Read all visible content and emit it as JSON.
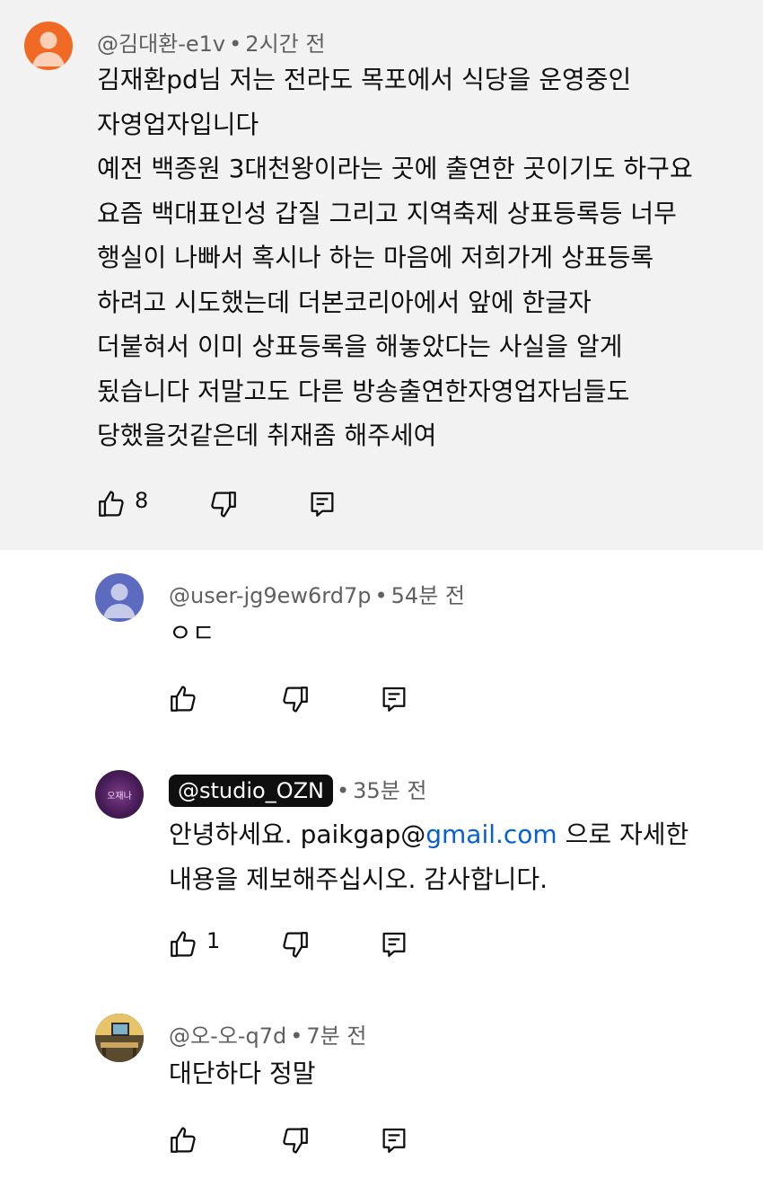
{
  "comments": [
    {
      "handle": "@김대환-e1v",
      "time": "2시간 전",
      "lines": [
        "김재환pd님 저는 전라도 목포에서 식당을 운영중인",
        "자영업자입니다",
        "예전 백종원 3대천왕이라는 곳에 출연한 곳이기도 하구요",
        "요즘 백대표인성 갑질 그리고 지역축제 상표등록등 너무",
        "행실이 나빠서 혹시나 하는 마음에 저희가게 상표등록",
        "하려고 시도했는데 더본코리아에서 앞에 한글자",
        "더붙혀서 이미 상표등록을 해놓았다는 사실을 알게",
        "됬습니다 저말고도 다른 방송출연한자영업자님들도",
        "당했을것같은데 취재좀 해주세여"
      ],
      "likes": "8",
      "avatar_color": "#f06a25"
    },
    {
      "handle": "@user-jg9ew6rd7p",
      "time": "54분 전",
      "text": "ㅇㄷ",
      "likes": "",
      "avatar_color": "#5c6bc0"
    },
    {
      "handle": "@studio_OZN",
      "time": "35분 전",
      "line1_before": "안녕하세요. paikgap@",
      "line1_link": "gmail.com",
      "line1_after": " 으로 자세한",
      "line2": "내용을 제보해주십시오. 감사합니다.",
      "likes": "1",
      "avatar_text": "오재나"
    },
    {
      "handle": "@오-오-q7d",
      "time": "7분 전",
      "text": "대단하다 정말",
      "likes": ""
    }
  ],
  "separator": "•",
  "icons": {
    "like": "thumb-up-icon",
    "dislike": "thumb-down-icon",
    "reply": "reply-icon"
  }
}
